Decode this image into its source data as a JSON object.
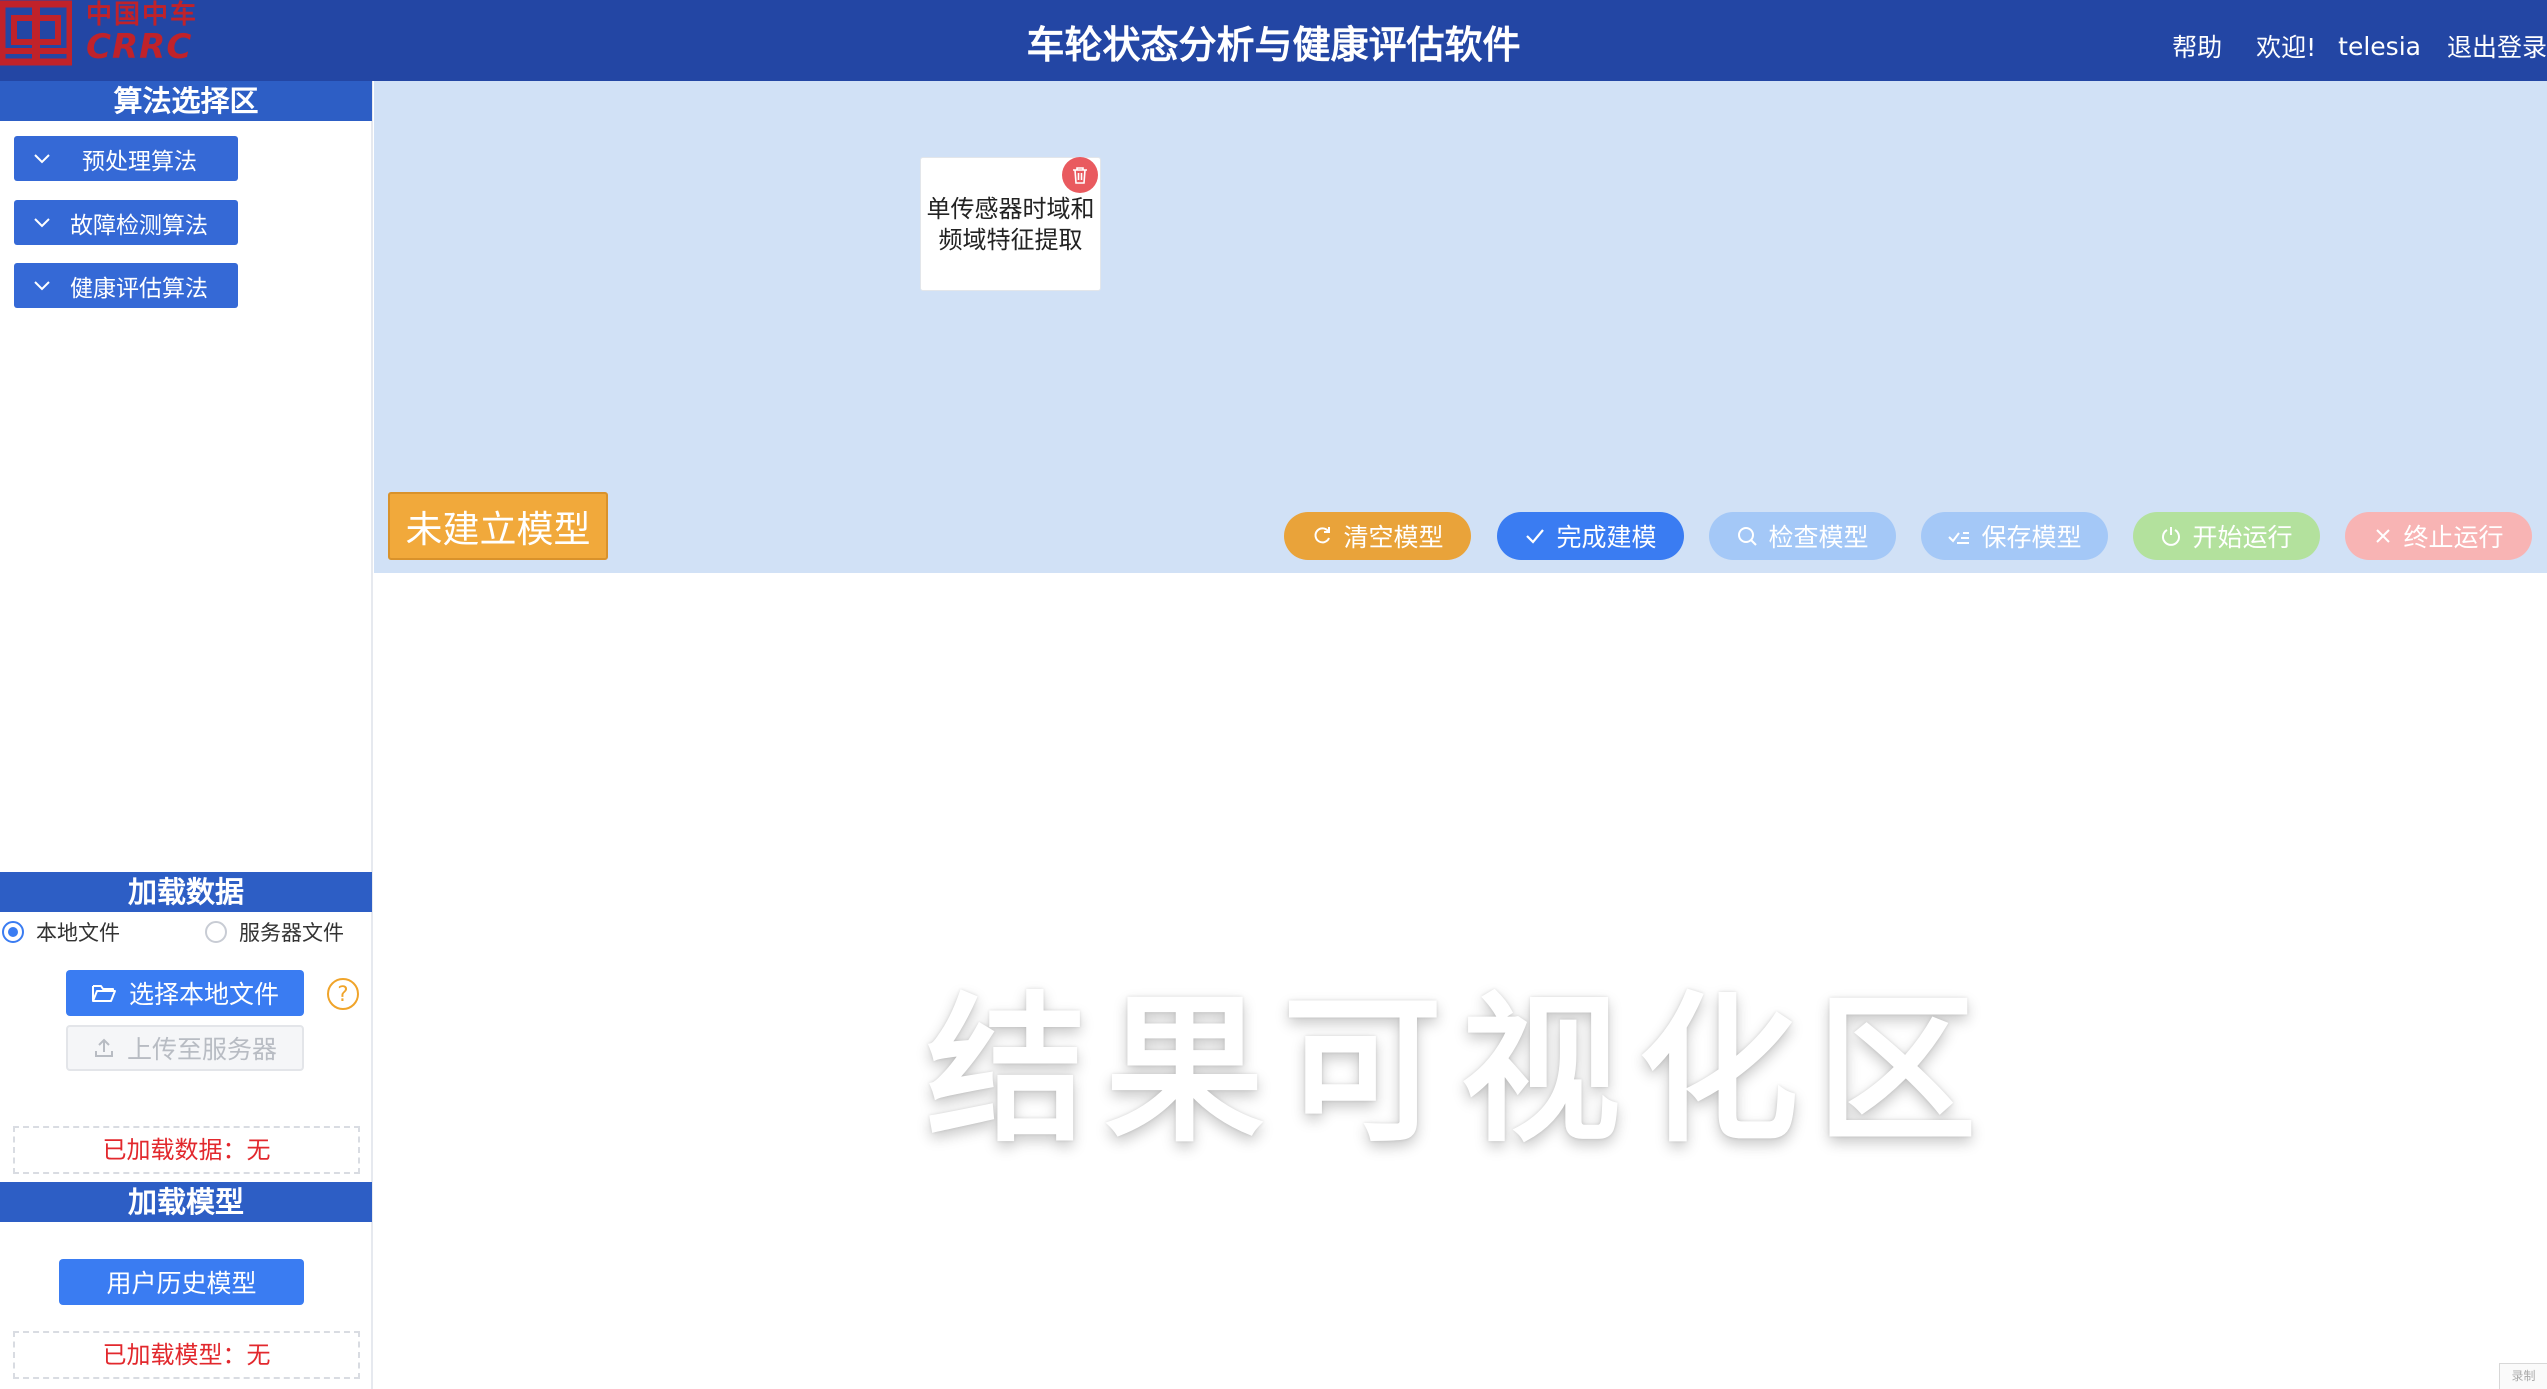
{
  "colors": {
    "header_bg": "#2346a4",
    "section_head_bg": "#2d5ec5",
    "canvas_bg": "#d1e1f6",
    "brand_red": "#c0222a",
    "primary": "#3a7cf2",
    "status_red": "#e2282d",
    "warning_orange": "#f1a93b"
  },
  "header": {
    "logo_cn": "中国中车",
    "logo_en": "CRRC",
    "title": "车轮状态分析与健康评估软件",
    "help": "帮助",
    "welcome": "欢迎!",
    "username": "telesia",
    "logout": "退出登录"
  },
  "sidebar": {
    "algo_section": {
      "title": "算法选择区",
      "items": [
        {
          "label": "预处理算法",
          "icon": "chevron-down-icon"
        },
        {
          "label": "故障检测算法",
          "icon": "chevron-down-icon"
        },
        {
          "label": "健康评估算法",
          "icon": "chevron-down-icon"
        }
      ]
    },
    "data_section": {
      "title": "加载数据",
      "source_options": [
        "本地文件",
        "服务器文件"
      ],
      "selected_source": "本地文件",
      "select_file_label": "选择本地文件",
      "upload_label": "上传至服务器",
      "loaded_status": "已加载数据：无"
    },
    "model_section": {
      "title": "加载模型",
      "history_label": "用户历史模型",
      "loaded_status": "已加载模型：无"
    }
  },
  "canvas": {
    "node_label": "单传感器时域和频域特征提取",
    "model_status": "未建立模型",
    "actions": [
      {
        "label": "清空模型",
        "icon": "refresh-icon",
        "color": "#e9a33a",
        "enabled": true
      },
      {
        "label": "完成建模",
        "icon": "check-icon",
        "color": "#3a7cf2",
        "enabled": true
      },
      {
        "label": "检查模型",
        "icon": "search-icon",
        "color": "#a4c8f7",
        "enabled": false
      },
      {
        "label": "保存模型",
        "icon": "save-check-icon",
        "color": "#a4c8f7",
        "enabled": false
      },
      {
        "label": "开始运行",
        "icon": "power-icon",
        "color": "#b3e19d",
        "enabled": false
      },
      {
        "label": "终止运行",
        "icon": "close-icon",
        "color": "#f8b4b4",
        "enabled": false
      }
    ]
  },
  "result": {
    "watermark": "结果可视化区",
    "corner_tag": "录制"
  }
}
